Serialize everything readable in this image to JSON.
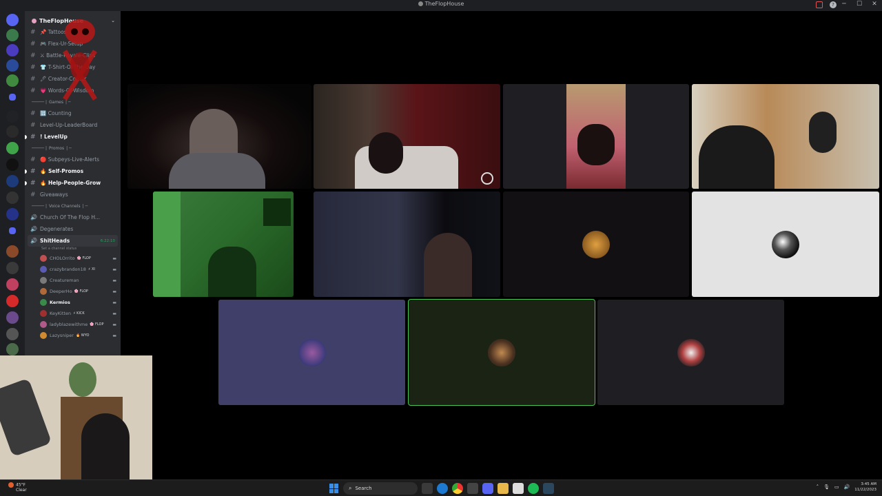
{
  "window": {
    "title": "TheFlopHouse"
  },
  "server": {
    "name": "TheFlopHouse"
  },
  "channels_top": [
    {
      "label": "📌 Tattoos"
    },
    {
      "label": "🎮 Flex-Ur-Setup"
    },
    {
      "label": "⚔ Battle-Royale-Clips"
    },
    {
      "label": "👕 T-Shirt-Of-The-Day"
    },
    {
      "label": "🖊 Creator-Corner"
    },
    {
      "label": "💗 Words-Of-Wisdom"
    }
  ],
  "cat_games": "Games",
  "channels_games": [
    {
      "label": "🔢 Counting",
      "bold": false
    },
    {
      "label": "Level-Up-LeaderBoard",
      "bold": false
    },
    {
      "label": "! LevelUp",
      "bold": true
    }
  ],
  "cat_promos": "Promos",
  "channels_promos": [
    {
      "label": "🔴 Subpeys-Live-Alerts",
      "bold": false
    },
    {
      "label": "🔥 Self-Promos",
      "bold": true
    },
    {
      "label": "🔥 Help-People-Grow",
      "bold": true
    },
    {
      "label": "Giveaways",
      "bold": false
    }
  ],
  "cat_voice": "Voice Channels",
  "voice_channels": [
    {
      "label": "Church Of The Flop H..."
    },
    {
      "label": "Degenerates"
    }
  ],
  "active_voice": {
    "label": "ShitHeads",
    "timer": "6:22:10",
    "status_hint": "Set a channel status"
  },
  "members": [
    {
      "name": "CHOLOrrito",
      "tag": "🌸 FLOP",
      "live": false
    },
    {
      "name": "crazybrandon18",
      "tag": "⚡ XI",
      "live": false
    },
    {
      "name": "Creatureman",
      "tag": "",
      "live": false
    },
    {
      "name": "DeeperHo",
      "tag": "🌸 FLOP",
      "live": false
    },
    {
      "name": "Kermios",
      "tag": "",
      "live": true
    },
    {
      "name": "KeyKitten",
      "tag": "⚡ KICK",
      "live": false
    },
    {
      "name": "ladyblazewithme",
      "tag": "🌸 FLOP",
      "live": false
    },
    {
      "name": "Lazysniper",
      "tag": "🔥 WYO",
      "live": false
    }
  ],
  "colors": {
    "tile_purple": "#403f69",
    "tile_green": "#1b2414",
    "tile_dark": "#1f1f23",
    "speaking_outline": "#4ec35a"
  },
  "taskbar": {
    "weather_temp": "45°F",
    "weather_desc": "Clear",
    "search_label": "Search",
    "time": "3:45 AM",
    "date": "11/22/2023"
  }
}
